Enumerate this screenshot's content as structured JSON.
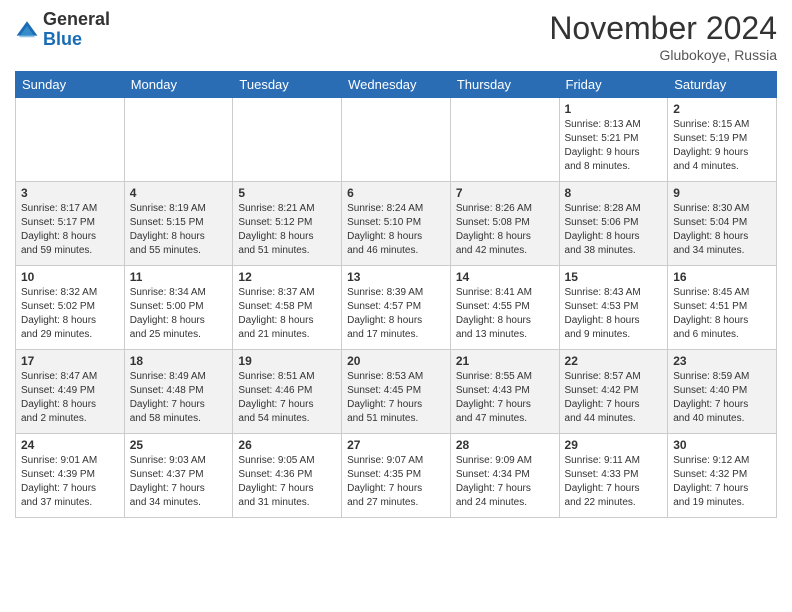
{
  "logo": {
    "general": "General",
    "blue": "Blue"
  },
  "title": "November 2024",
  "location": "Glubokoye, Russia",
  "days_of_week": [
    "Sunday",
    "Monday",
    "Tuesday",
    "Wednesday",
    "Thursday",
    "Friday",
    "Saturday"
  ],
  "weeks": [
    [
      {
        "day": "",
        "info": ""
      },
      {
        "day": "",
        "info": ""
      },
      {
        "day": "",
        "info": ""
      },
      {
        "day": "",
        "info": ""
      },
      {
        "day": "",
        "info": ""
      },
      {
        "day": "1",
        "info": "Sunrise: 8:13 AM\nSunset: 5:21 PM\nDaylight: 9 hours\nand 8 minutes."
      },
      {
        "day": "2",
        "info": "Sunrise: 8:15 AM\nSunset: 5:19 PM\nDaylight: 9 hours\nand 4 minutes."
      }
    ],
    [
      {
        "day": "3",
        "info": "Sunrise: 8:17 AM\nSunset: 5:17 PM\nDaylight: 8 hours\nand 59 minutes."
      },
      {
        "day": "4",
        "info": "Sunrise: 8:19 AM\nSunset: 5:15 PM\nDaylight: 8 hours\nand 55 minutes."
      },
      {
        "day": "5",
        "info": "Sunrise: 8:21 AM\nSunset: 5:12 PM\nDaylight: 8 hours\nand 51 minutes."
      },
      {
        "day": "6",
        "info": "Sunrise: 8:24 AM\nSunset: 5:10 PM\nDaylight: 8 hours\nand 46 minutes."
      },
      {
        "day": "7",
        "info": "Sunrise: 8:26 AM\nSunset: 5:08 PM\nDaylight: 8 hours\nand 42 minutes."
      },
      {
        "day": "8",
        "info": "Sunrise: 8:28 AM\nSunset: 5:06 PM\nDaylight: 8 hours\nand 38 minutes."
      },
      {
        "day": "9",
        "info": "Sunrise: 8:30 AM\nSunset: 5:04 PM\nDaylight: 8 hours\nand 34 minutes."
      }
    ],
    [
      {
        "day": "10",
        "info": "Sunrise: 8:32 AM\nSunset: 5:02 PM\nDaylight: 8 hours\nand 29 minutes."
      },
      {
        "day": "11",
        "info": "Sunrise: 8:34 AM\nSunset: 5:00 PM\nDaylight: 8 hours\nand 25 minutes."
      },
      {
        "day": "12",
        "info": "Sunrise: 8:37 AM\nSunset: 4:58 PM\nDaylight: 8 hours\nand 21 minutes."
      },
      {
        "day": "13",
        "info": "Sunrise: 8:39 AM\nSunset: 4:57 PM\nDaylight: 8 hours\nand 17 minutes."
      },
      {
        "day": "14",
        "info": "Sunrise: 8:41 AM\nSunset: 4:55 PM\nDaylight: 8 hours\nand 13 minutes."
      },
      {
        "day": "15",
        "info": "Sunrise: 8:43 AM\nSunset: 4:53 PM\nDaylight: 8 hours\nand 9 minutes."
      },
      {
        "day": "16",
        "info": "Sunrise: 8:45 AM\nSunset: 4:51 PM\nDaylight: 8 hours\nand 6 minutes."
      }
    ],
    [
      {
        "day": "17",
        "info": "Sunrise: 8:47 AM\nSunset: 4:49 PM\nDaylight: 8 hours\nand 2 minutes."
      },
      {
        "day": "18",
        "info": "Sunrise: 8:49 AM\nSunset: 4:48 PM\nDaylight: 7 hours\nand 58 minutes."
      },
      {
        "day": "19",
        "info": "Sunrise: 8:51 AM\nSunset: 4:46 PM\nDaylight: 7 hours\nand 54 minutes."
      },
      {
        "day": "20",
        "info": "Sunrise: 8:53 AM\nSunset: 4:45 PM\nDaylight: 7 hours\nand 51 minutes."
      },
      {
        "day": "21",
        "info": "Sunrise: 8:55 AM\nSunset: 4:43 PM\nDaylight: 7 hours\nand 47 minutes."
      },
      {
        "day": "22",
        "info": "Sunrise: 8:57 AM\nSunset: 4:42 PM\nDaylight: 7 hours\nand 44 minutes."
      },
      {
        "day": "23",
        "info": "Sunrise: 8:59 AM\nSunset: 4:40 PM\nDaylight: 7 hours\nand 40 minutes."
      }
    ],
    [
      {
        "day": "24",
        "info": "Sunrise: 9:01 AM\nSunset: 4:39 PM\nDaylight: 7 hours\nand 37 minutes."
      },
      {
        "day": "25",
        "info": "Sunrise: 9:03 AM\nSunset: 4:37 PM\nDaylight: 7 hours\nand 34 minutes."
      },
      {
        "day": "26",
        "info": "Sunrise: 9:05 AM\nSunset: 4:36 PM\nDaylight: 7 hours\nand 31 minutes."
      },
      {
        "day": "27",
        "info": "Sunrise: 9:07 AM\nSunset: 4:35 PM\nDaylight: 7 hours\nand 27 minutes."
      },
      {
        "day": "28",
        "info": "Sunrise: 9:09 AM\nSunset: 4:34 PM\nDaylight: 7 hours\nand 24 minutes."
      },
      {
        "day": "29",
        "info": "Sunrise: 9:11 AM\nSunset: 4:33 PM\nDaylight: 7 hours\nand 22 minutes."
      },
      {
        "day": "30",
        "info": "Sunrise: 9:12 AM\nSunset: 4:32 PM\nDaylight: 7 hours\nand 19 minutes."
      }
    ]
  ]
}
